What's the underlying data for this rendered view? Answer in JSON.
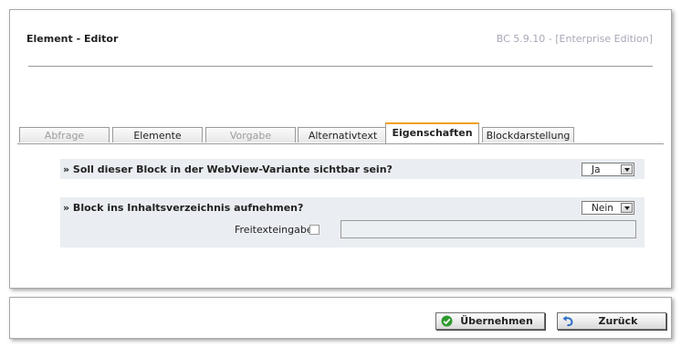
{
  "window": {
    "title": "Element - Editor",
    "version": "BC 5.9.10 - [Enterprise Edition]"
  },
  "tabs": [
    {
      "label": "Abfrage",
      "state": "disabled"
    },
    {
      "label": "Elemente",
      "state": "normal"
    },
    {
      "label": "Vorgabe",
      "state": "disabled"
    },
    {
      "label": "Alternativtext",
      "state": "normal"
    },
    {
      "label": "Eigenschaften",
      "state": "active"
    },
    {
      "label": "Blockdarstellung",
      "state": "normal"
    }
  ],
  "settings": {
    "webview": {
      "question": "» Soll dieser Block in der WebView-Variante sichtbar sein?",
      "value": "Ja"
    },
    "toc": {
      "question": "» Block ins Inhaltsverzeichnis aufnehmen?",
      "value": "Nein"
    },
    "freetext": {
      "label": "Freitexteingabe",
      "checked": false,
      "value": ""
    }
  },
  "footer": {
    "apply_label": "Übernehmen",
    "apply_icon": "green-check-icon",
    "back_label": "Zurück",
    "back_icon": "undo-arrow-icon"
  },
  "colors": {
    "active_tab_accent": "#f2a21c",
    "version_text": "#a8a8b8",
    "section_background": "#eaedf1",
    "apply_icon": "#2e9a2e",
    "back_icon": "#2f6fc9"
  }
}
